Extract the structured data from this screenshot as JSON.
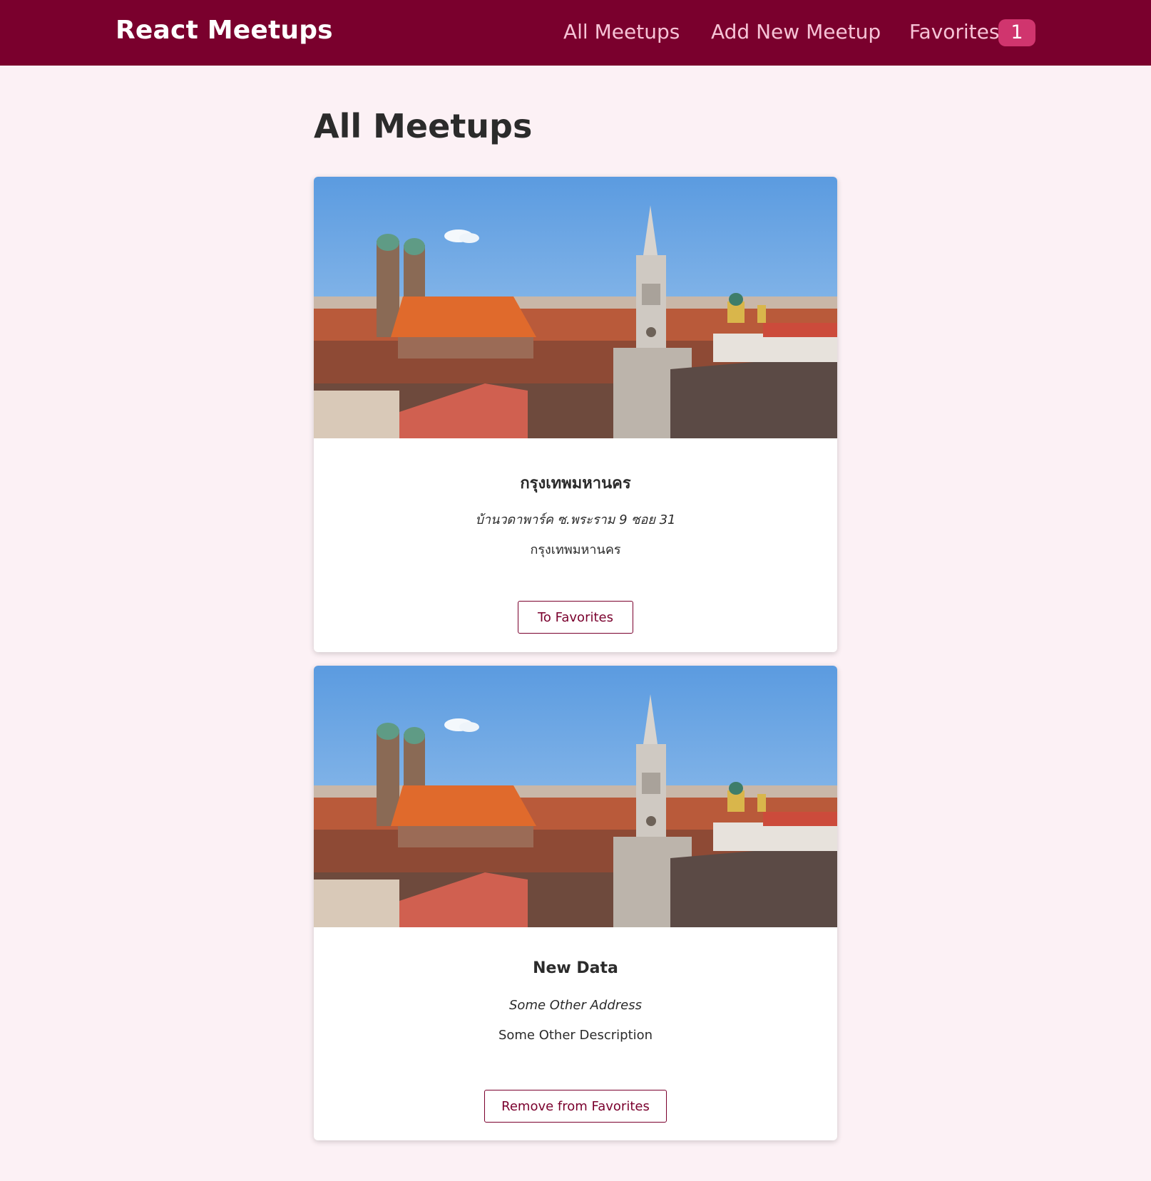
{
  "header": {
    "logo": "React Meetups",
    "nav": {
      "all_meetups": "All Meetups",
      "add_new": "Add New Meetup",
      "favorites": "Favorites",
      "favorites_count": "1"
    }
  },
  "main": {
    "title": "All Meetups",
    "meetups": [
      {
        "title": "กรุงเทพมหานคร",
        "address": "บ้านวดาพาร์ค ซ.พระราม 9 ซอย 31",
        "description": "กรุงเทพมหานคร",
        "button_label": "To Favorites"
      },
      {
        "title": "New Data",
        "address": "Some Other Address",
        "description": "Some Other Description",
        "button_label": "Remove from Favorites"
      }
    ]
  },
  "colors": {
    "brand": "#7a002d",
    "badge": "#d0356e",
    "background": "#fcf1f5",
    "nav_text": "#f6c3d6"
  }
}
